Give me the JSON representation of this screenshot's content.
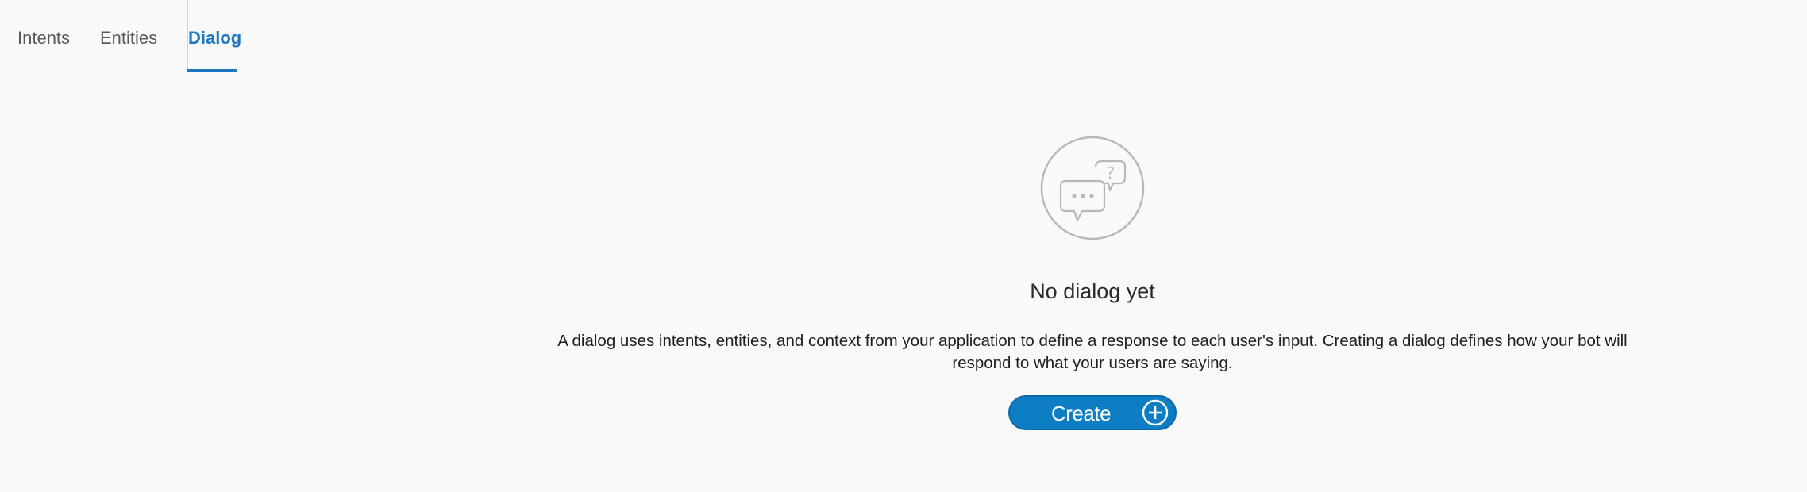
{
  "tabs": [
    {
      "label": "Intents",
      "active": false
    },
    {
      "label": "Entities",
      "active": false
    },
    {
      "label": "Dialog",
      "active": true
    }
  ],
  "empty_state": {
    "icon": "chat-bubbles-icon",
    "title": "No dialog yet",
    "description": "A dialog uses intents, entities, and context from your application to define a response to each user's input. Creating a dialog defines how your bot will respond to what your users are saying.",
    "create_button": {
      "label": "Create",
      "icon": "plus-circle-icon"
    }
  },
  "colors": {
    "accent": "#1f76c0",
    "button": "#0d7ec4",
    "background": "#f9f9f9",
    "icon_gray": "#b8b8b8"
  }
}
